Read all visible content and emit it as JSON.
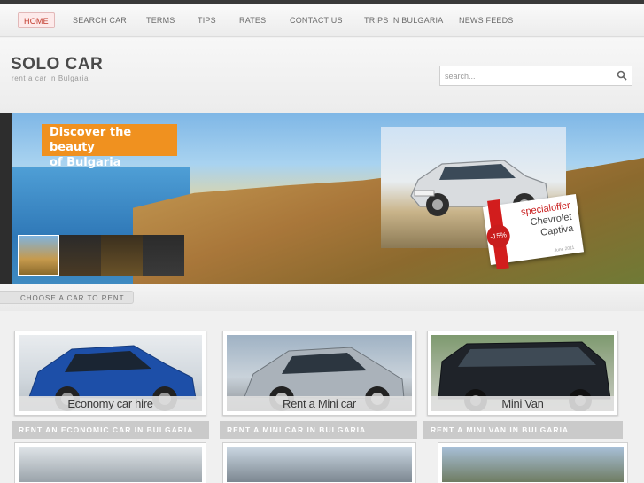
{
  "nav": {
    "items": [
      {
        "label": "HOME",
        "active": true
      },
      {
        "label": "SEARCH CAR",
        "active": false
      },
      {
        "label": "TERMS",
        "active": false
      },
      {
        "label": "TIPS",
        "active": false
      },
      {
        "label": "RATES",
        "active": false
      },
      {
        "label": "CONTACT US",
        "active": false
      },
      {
        "label": "TRIPS IN BULGARIA",
        "active": false
      },
      {
        "label": "NEWS FEEDS",
        "active": false
      }
    ]
  },
  "header": {
    "logo": "SOLO CAR",
    "tagline": "rent a car in Bulgaria",
    "search_placeholder": "search..."
  },
  "banner": {
    "headline_line1": "Discover the beauty",
    "headline_line2": "of Bulgaria",
    "offer": {
      "special": "specialoffer",
      "make": "Chevrolet",
      "model": "Captiva",
      "discount": "-15%",
      "date": "June 2011"
    },
    "thumbnail_count": 4
  },
  "section": {
    "title": "CHOOSE A CAR TO RENT"
  },
  "cards": [
    {
      "caption": "Economy car hire",
      "label": "RENT AN ECONOMIC CAR IN BULGARIA"
    },
    {
      "caption": "Rent a Mini car",
      "label": "RENT A MINI CAR IN BULGARIA"
    },
    {
      "caption": "Mini Van",
      "label": "RENT A MINI VAN IN BULGARIA"
    }
  ],
  "colors": {
    "accent_orange": "#f0911f",
    "offer_red": "#c91d1d",
    "nav_active": "#c0392b"
  }
}
